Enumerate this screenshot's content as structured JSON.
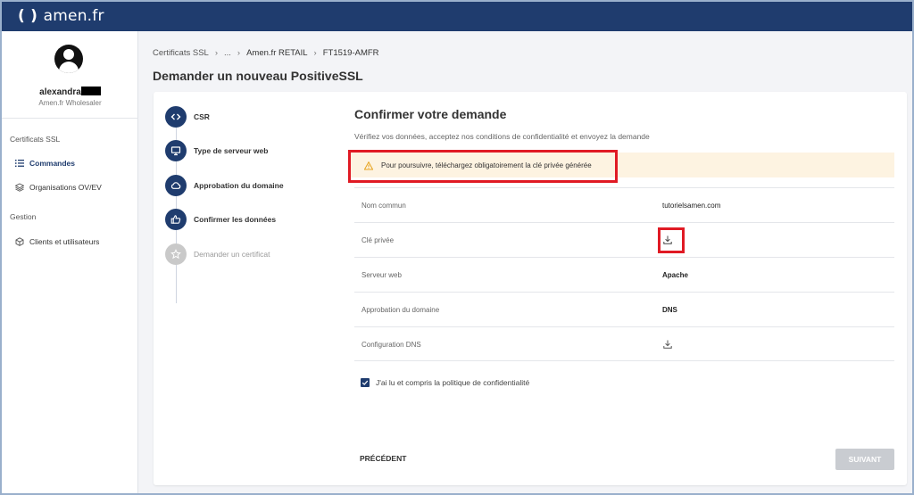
{
  "brand": {
    "logo_text": "amen.fr",
    "logo_mark": "( )"
  },
  "colors": {
    "navy": "#1f3c6e",
    "alert_bg": "#fdf3e1",
    "highlight_red": "#e01a24",
    "disabled_button": "#c9ccd1"
  },
  "user": {
    "name": "alexandra",
    "role": "Amen.fr Wholesaler"
  },
  "sidebar": {
    "section_ssl": "Certificats SSL",
    "items_ssl": [
      {
        "label": "Commandes",
        "icon": "list-icon"
      },
      {
        "label": "Organisations OV/EV",
        "icon": "layers-icon"
      }
    ],
    "section_manage": "Gestion",
    "items_manage": [
      {
        "label": "Clients et utilisateurs",
        "icon": "cube-icon"
      }
    ]
  },
  "breadcrumb": [
    "Certificats SSL",
    "...",
    "Amen.fr RETAIL",
    "FT1519-AMFR"
  ],
  "page_title": "Demander un nouveau PositiveSSL",
  "steps": [
    {
      "label": "CSR",
      "icon": "code-icon"
    },
    {
      "label": "Type de serveur web",
      "icon": "monitor-icon"
    },
    {
      "label": "Approbation du domaine",
      "icon": "cloud-icon"
    },
    {
      "label": "Confirmer les données",
      "icon": "thumbs-up-icon"
    },
    {
      "label": "Demander un certificat",
      "icon": "star-icon"
    }
  ],
  "confirm": {
    "title": "Confirmer votre demande",
    "subtitle": "Vérifiez vos données, acceptez nos conditions de confidentialité et envoyez la demande",
    "alert": "Pour poursuivre, téléchargez obligatoirement la clé privée générée",
    "rows": [
      {
        "label": "Nom commun",
        "value": "tutorielsamen.com"
      },
      {
        "label": "Clé privée",
        "value": ""
      },
      {
        "label": "Serveur web",
        "value": "Apache"
      },
      {
        "label": "Approbation du domaine",
        "value": "DNS"
      },
      {
        "label": "Configuration DNS",
        "value": ""
      }
    ],
    "checkbox_label": "J'ai lu et compris la politique de confidentialité",
    "checkbox_checked": true,
    "prev_label": "PRÉCÉDENT",
    "next_label": "SUIVANT"
  }
}
